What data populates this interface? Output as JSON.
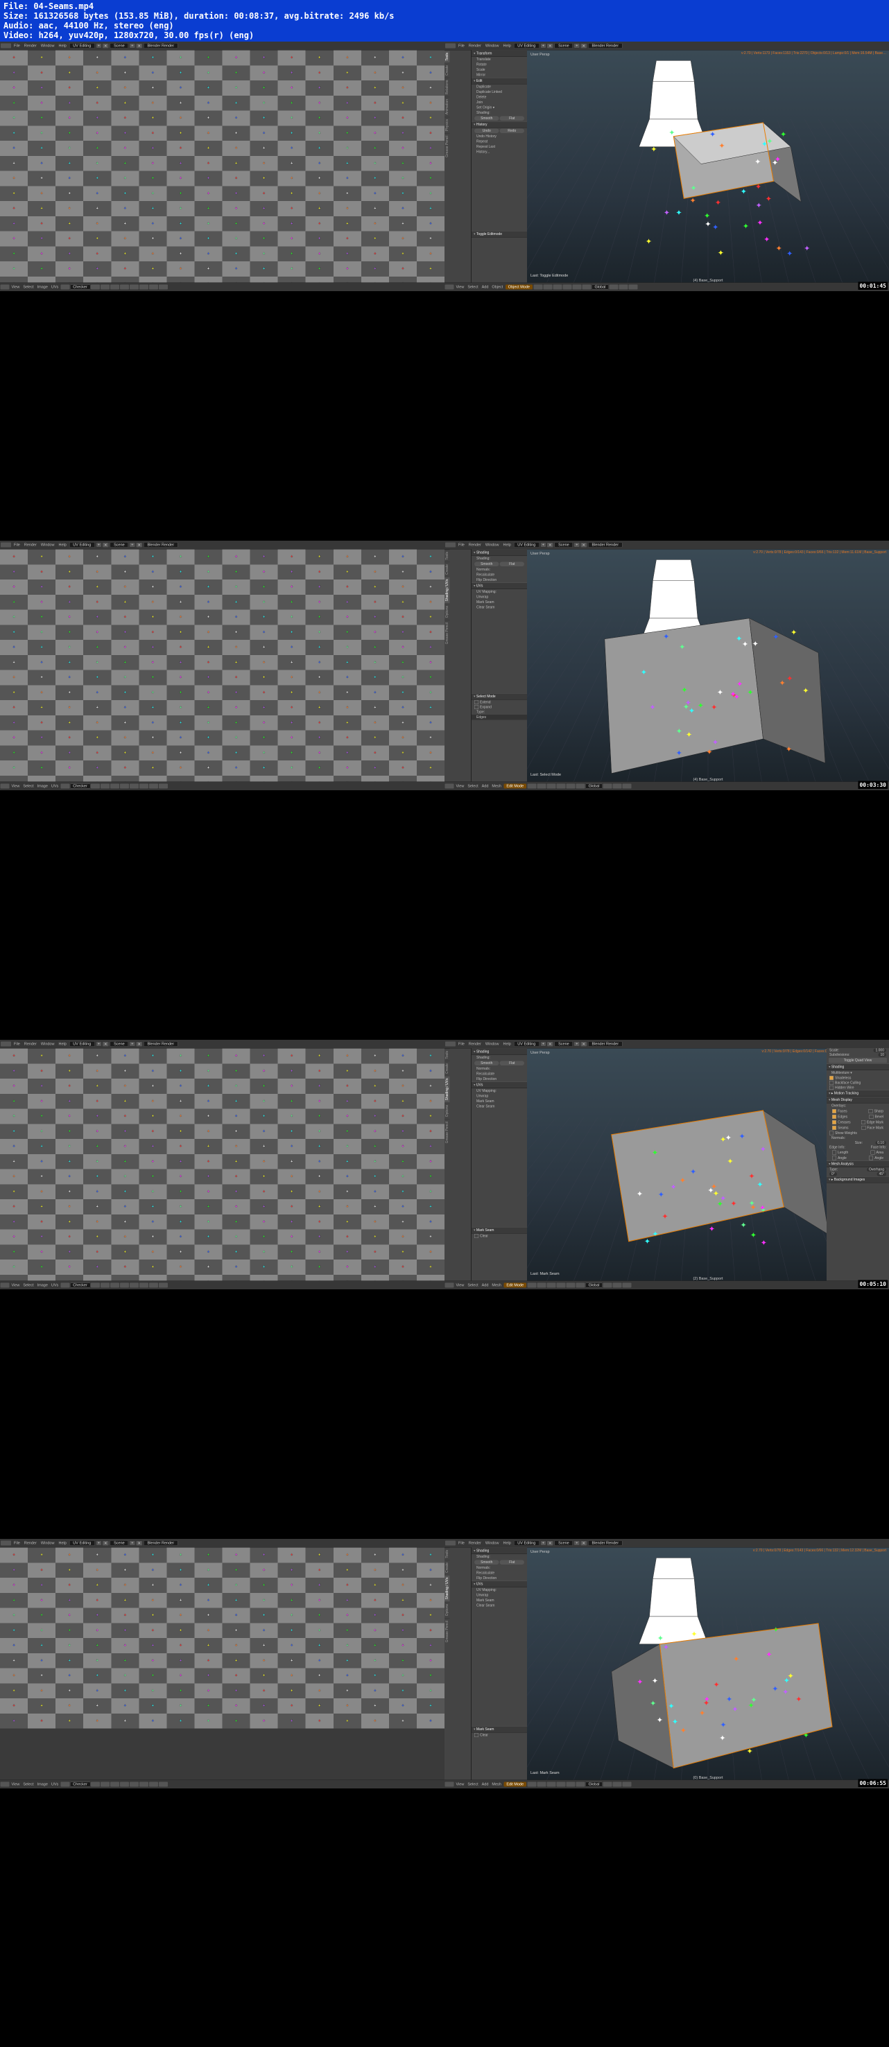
{
  "file_info": {
    "l1": "File: 04-Seams.mp4",
    "l2": "Size: 161326568 bytes (153.85 MiB), duration: 00:08:37, avg.bitrate: 2496 kb/s",
    "l3": "Audio: aac, 44100 Hz, stereo (eng)",
    "l4": "Video: h264, yuv420p, 1280x720, 30.00 fps(r) (eng)"
  },
  "topmenu": {
    "file": "File",
    "render": "Render",
    "window": "Window",
    "help": "Help",
    "layout": "UV Editing",
    "scene": "Scene",
    "engine": "Blender Render"
  },
  "uvfooter": {
    "view": "View",
    "select": "Select",
    "image": "Image",
    "uvs": "UVs",
    "img": "Checker"
  },
  "vpfooter": {
    "view": "View",
    "select": "Select",
    "add": "Add",
    "object": "Object",
    "mesh": "Mesh",
    "objmode": "Object Mode",
    "editmode": "Edit Mode",
    "orient": "Global"
  },
  "persp": "User Persp",
  "frames": [
    {
      "timecode": "00:01:45",
      "stats": "v:2.70 | Verts:1173 | Faces:1153 | Tris:2270 | Objects:0/13 | Lamps:0/1 | Mem:16.54M | Base…",
      "last": "Last: Toggle Editmode",
      "objname": "(4) Base_Support",
      "toolpanel": {
        "sections": [
          {
            "title": "Transform",
            "items": [
              "Translate",
              "Rotate",
              "Scale",
              "Mirror"
            ]
          },
          {
            "title": "Edit",
            "items": [
              "Duplicate",
              "Duplicate Linked",
              "Delete",
              "Join"
            ],
            "extra": [
              {
                "label": "Set Origin",
                "type": "drop"
              }
            ]
          },
          {
            "title": "",
            "items": [],
            "shading": true
          },
          {
            "title": "History",
            "items": [],
            "history": true
          }
        ],
        "shading_label": "Shading:",
        "smooth": "Smooth",
        "flat": "Flat",
        "undo": "Undo",
        "redo": "Redo",
        "undohist": "Undo History",
        "repeat": "Repeat",
        "repeatlast": "Repeat Last",
        "history": "History...",
        "toggle": "Toggle Editmode"
      },
      "tabs": [
        "Tools",
        "Create",
        "Relations",
        "Animation",
        "Physics",
        "Grease Pencil"
      ],
      "mode": "object"
    },
    {
      "timecode": "00:03:30",
      "stats": "v:2.70 | Verts:0/78 | Edges:0/143 | Faces:0/66 | Tris:132 | Mem:11.61M | Base_Support",
      "last": "Last: Select Mode",
      "objname": "(4) Base_Support",
      "toolpanel": {
        "sections": [
          {
            "title": "Shading",
            "shading": true,
            "items": [
              "Normals:",
              "Recalculate",
              "Flip Direction"
            ]
          },
          {
            "title": "UVs",
            "items": [
              "UV Mapping:",
              "Unwrap",
              "Mark Seam",
              "Clear Seam"
            ]
          }
        ],
        "shading_label": "Shading:",
        "smooth": "Smooth",
        "flat": "Flat",
        "selmode": "Select Mode",
        "extend": "Extend",
        "expand": "Expand",
        "type": "Type:",
        "edges": "Edges"
      },
      "tabs": [
        "Tools",
        "Create",
        "Shading / UVs",
        "Options",
        "Grease Pencil"
      ],
      "mode": "edit"
    },
    {
      "timecode": "00:05:10",
      "stats": "v:2.70 | Verts:0/78 | Edges:0/142 | Faces:0/66 | Tris:132 | Mem:12.05M | Base_…",
      "last": "Last: Mark Seam",
      "objname": "(2) Base_Support",
      "toolpanel": {
        "sections": [
          {
            "title": "Shading",
            "shading": true,
            "items": [
              "Normals:",
              "Recalculate",
              "Flip Direction"
            ]
          },
          {
            "title": "UVs",
            "items": [
              "UV Mapping:",
              "Unwrap",
              "Mark Seam",
              "Clear Seam"
            ]
          }
        ],
        "shading_label": "Shading:",
        "smooth": "Smooth",
        "flat": "Flat",
        "markseam": "Mark Seam",
        "clear": "Clear"
      },
      "tabs": [
        "Tools",
        "Create",
        "Shading / UVs",
        "Options",
        "Grease Pencil"
      ],
      "mode": "edit",
      "npanel": {
        "scale": "Scale:",
        "scaleval": "1.000",
        "subdiv": "Subdivisions:",
        "subdivval": "10",
        "togglequad": "Toggle Quad View",
        "s_shading": "Shading",
        "multitex": "Multitexture",
        "shadeless": "Shadeless",
        "backface": "Backface Culling",
        "hidden": "Hidden Wire",
        "s_motion": "Motion Tracking",
        "s_meshdisp": "Mesh Display",
        "overlays": "Overlays:",
        "faces": "Faces",
        "sharp": "Sharp",
        "edges": "Edges",
        "bevel": "Bevel",
        "creases": "Creases",
        "edgemark": "Edge Mark",
        "seams": "Seams",
        "facemark": "Face Mark",
        "showweights": "Show Weights",
        "normals": "Normals:",
        "size": "Size:",
        "sizeval": "0.10",
        "edgeinfo": "Edge Info:",
        "faceinfo": "Face Info:",
        "length": "Length",
        "area": "Area",
        "angle": "Angle",
        "angle2": "Angle",
        "s_meshana": "Mesh Analysis",
        "type": "Type:",
        "overhang": "Overhang",
        "v1": "0°",
        "v2": "45°",
        "s_bgimg": "Background Images"
      }
    },
    {
      "timecode": "00:06:55",
      "stats": "v:2.70 | Verts:0/78 | Edges:7/143 | Faces:0/66 | Tris:132 | Mem:12.32M | Base_Support",
      "last": "Last: Mark Seam",
      "objname": "(0) Base_Support",
      "toolpanel": {
        "sections": [
          {
            "title": "Shading",
            "shading": true,
            "items": [
              "Normals:",
              "Recalculate",
              "Flip Direction"
            ]
          },
          {
            "title": "UVs",
            "items": [
              "UV Mapping:",
              "Unwrap",
              "Mark Seam",
              "Clear Seam"
            ]
          }
        ],
        "shading_label": "Shading:",
        "smooth": "Smooth",
        "flat": "Flat",
        "markseam": "Mark Seam",
        "clear": "Clear"
      },
      "tabs": [
        "Tools",
        "Create",
        "Shading / UVs",
        "Options",
        "Grease Pencil"
      ],
      "mode": "edit",
      "checker_partial": true
    }
  ],
  "plus_colors": [
    "#ff3030",
    "#30ff30",
    "#3060ff",
    "#ffff30",
    "#ff30ff",
    "#30ffff",
    "#ff8030",
    "#c060ff",
    "#60ff90",
    "#ffffff"
  ]
}
